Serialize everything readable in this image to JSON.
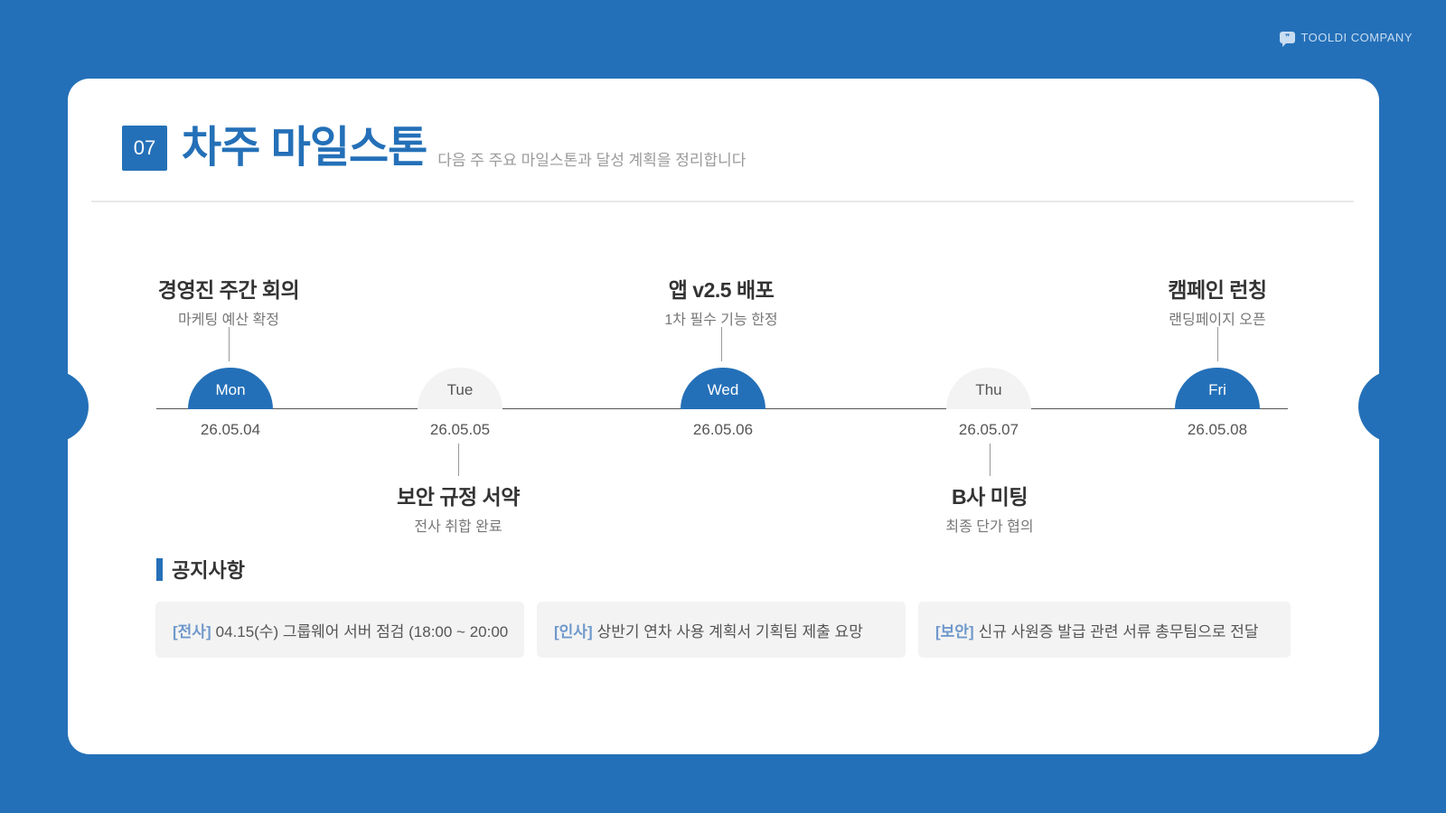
{
  "brand": {
    "name": "TOOLDI COMPANY",
    "icon": "chat-bubble-icon"
  },
  "header": {
    "section_number": "07",
    "title": "차주 마일스톤",
    "subtitle": "다음 주 주요 마일스톤과 달성 계획을 정리합니다"
  },
  "days": [
    {
      "day": "Mon",
      "date": "26.05.04",
      "active": true
    },
    {
      "day": "Tue",
      "date": "26.05.05",
      "active": false
    },
    {
      "day": "Wed",
      "date": "26.05.06",
      "active": true
    },
    {
      "day": "Thu",
      "date": "26.05.07",
      "active": false
    },
    {
      "day": "Fri",
      "date": "26.05.08",
      "active": true
    }
  ],
  "events": [
    {
      "title": "경영진 주간 회의",
      "desc": "마케팅 예산 확정"
    },
    {
      "title": "보안 규정 서약",
      "desc": "전사 취합 완료"
    },
    {
      "title": "앱 v2.5 배포",
      "desc": "1차 필수 기능 한정"
    },
    {
      "title": "B사 미팅",
      "desc": "최종 단가 협의"
    },
    {
      "title": "캠페인 런칭",
      "desc": "랜딩페이지 오픈"
    }
  ],
  "notices": {
    "heading": "공지사항",
    "items": [
      {
        "tag": "[전사]",
        "text": "04.15(수) 그룹웨어 서버 점검 (18:00 ~ 20:00"
      },
      {
        "tag": "[인사]",
        "text": "상반기 연차 사용 계획서 기획팀 제출 요망"
      },
      {
        "tag": "[보안]",
        "text": "신규 사원증 발급 관련 서류 총무팀으로 전달"
      }
    ]
  },
  "colors": {
    "primary": "#2470b8",
    "tag": "#6e98cb",
    "inactive_day": "#f3f3f3"
  }
}
